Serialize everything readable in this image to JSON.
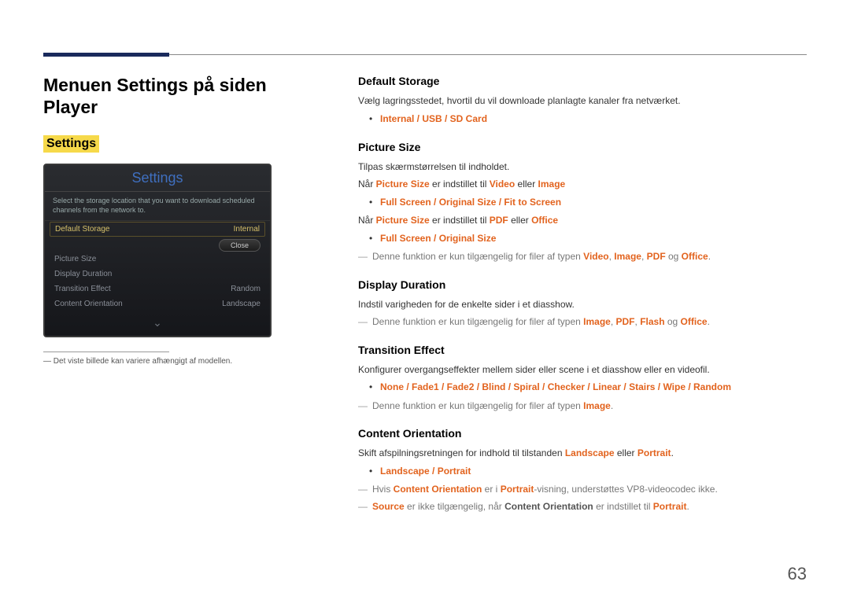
{
  "page_number": "63",
  "main_title": "Menuen Settings på siden Player",
  "settings_heading": "Settings",
  "device": {
    "title": "Settings",
    "subtitle": "Select the storage location that you want to download scheduled channels from the network to.",
    "rows": [
      {
        "label": "Default Storage",
        "value": "Internal",
        "selected": true
      },
      {
        "label": "Picture Size",
        "value": ""
      },
      {
        "label": "Display Duration",
        "value": ""
      },
      {
        "label": "Transition Effect",
        "value": "Random"
      },
      {
        "label": "Content Orientation",
        "value": "Landscape"
      }
    ],
    "close": "Close"
  },
  "footnote": "Det viste billede kan variere afhængigt af modellen.",
  "sections": {
    "default_storage": {
      "heading": "Default Storage",
      "p1": "Vælg lagringsstedet, hvortil du vil downloade planlagte kanaler fra netværket.",
      "opt": "Internal / USB / SD Card"
    },
    "picture_size": {
      "heading": "Picture Size",
      "p1": "Tilpas skærmstørrelsen til indholdet.",
      "p2_a": "Når ",
      "p2_b": "Picture Size",
      "p2_c": " er indstillet til ",
      "p2_d": "Video",
      "p2_e": " eller ",
      "p2_f": "Image",
      "opt1": "Full Screen / Original Size / Fit to Screen",
      "p3_a": "Når ",
      "p3_b": "Picture Size",
      "p3_c": " er indstillet til ",
      "p3_d": "PDF",
      "p3_e": " eller ",
      "p3_f": "Office",
      "opt2": "Full Screen / Original Size",
      "note_a": "Denne funktion er kun tilgængelig for filer af typen ",
      "note_b": "Video",
      "note_c": ", ",
      "note_d": "Image",
      "note_e": ", ",
      "note_f": "PDF",
      "note_g": " og ",
      "note_h": "Office",
      "note_i": "."
    },
    "display_duration": {
      "heading": "Display Duration",
      "p1": "Indstil varigheden for de enkelte sider i et diasshow.",
      "note_a": "Denne funktion er kun tilgængelig for filer af typen ",
      "note_b": "Image",
      "note_c": ", ",
      "note_d": "PDF",
      "note_e": ", ",
      "note_f": "Flash",
      "note_g": " og ",
      "note_h": "Office",
      "note_i": "."
    },
    "transition_effect": {
      "heading": "Transition Effect",
      "p1": "Konfigurer overgangseffekter mellem sider eller scene i et diasshow eller en videofil.",
      "opt": "None / Fade1 / Fade2 / Blind / Spiral / Checker / Linear / Stairs / Wipe / Random",
      "note_a": "Denne funktion er kun tilgængelig for filer af typen ",
      "note_b": "Image",
      "note_c": "."
    },
    "content_orientation": {
      "heading": "Content Orientation",
      "p1_a": "Skift afspilningsretningen for indhold til tilstanden ",
      "p1_b": "Landscape",
      "p1_c": " eller ",
      "p1_d": "Portrait",
      "p1_e": ".",
      "opt": "Landscape / Portrait",
      "note1_a": "Hvis ",
      "note1_b": "Content Orientation",
      "note1_c": " er i ",
      "note1_d": "Portrait",
      "note1_e": "-visning, understøttes VP8-videocodec ikke.",
      "note2_a": "Source",
      "note2_b": " er ikke tilgængelig, når ",
      "note2_c": "Content Orientation",
      "note2_d": " er indstillet til ",
      "note2_e": "Portrait",
      "note2_f": "."
    }
  }
}
